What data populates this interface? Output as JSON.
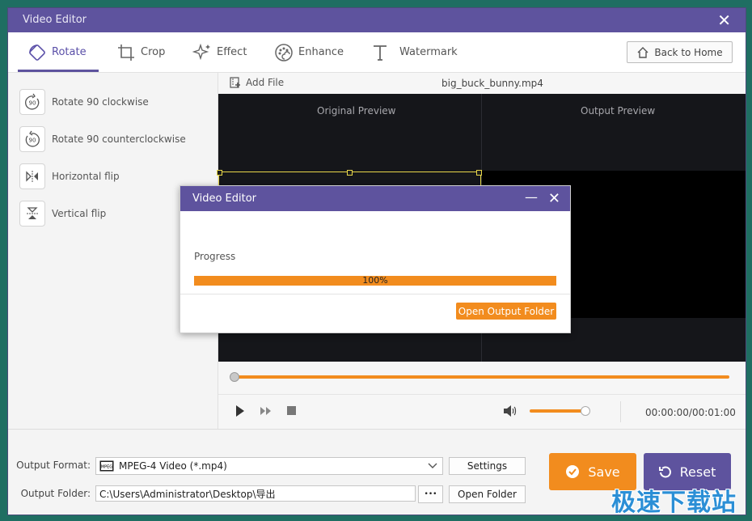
{
  "window": {
    "title": "Video Editor"
  },
  "tabs": [
    {
      "label": "Rotate",
      "icon": "rotate-icon",
      "active": true
    },
    {
      "label": "Crop",
      "icon": "crop-icon"
    },
    {
      "label": "Effect",
      "icon": "effect-icon"
    },
    {
      "label": "Enhance",
      "icon": "enhance-icon"
    },
    {
      "label": "Watermark",
      "icon": "watermark-icon"
    }
  ],
  "back_home": "Back to Home",
  "rotate_options": [
    {
      "label": "Rotate 90 clockwise",
      "icon": "rotate-clockwise-icon"
    },
    {
      "label": "Rotate 90 counterclockwise",
      "icon": "rotate-counterclockwise-icon"
    },
    {
      "label": "Horizontal flip",
      "icon": "horizontal-flip-icon"
    },
    {
      "label": "Vertical flip",
      "icon": "vertical-flip-icon"
    }
  ],
  "file_bar": {
    "add_file": "Add File",
    "file_name": "big_buck_bunny.mp4"
  },
  "preview": {
    "original": "Original Preview",
    "output": "Output Preview"
  },
  "player": {
    "time": "00:00:00/00:01:00",
    "seek_progress": 0.0,
    "volume": 0.9
  },
  "output": {
    "format_label": "Output Format:",
    "format_value": "MPEG-4 Video (*.mp4)",
    "settings": "Settings",
    "folder_label": "Output Folder:",
    "folder_value": "C:\\Users\\Administrator\\Desktop\\导出",
    "browse": "•••",
    "open_folder": "Open Folder"
  },
  "actions": {
    "save": "Save",
    "reset": "Reset"
  },
  "dialog": {
    "title": "Video Editor",
    "progress_label": "Progress",
    "progress_text": "100%",
    "progress_value": 1.0,
    "open_output": "Open Output Folder"
  },
  "watermark_text": "极速下载站",
  "colors": {
    "accent": "#5e539e",
    "orange": "#f28c1e"
  }
}
